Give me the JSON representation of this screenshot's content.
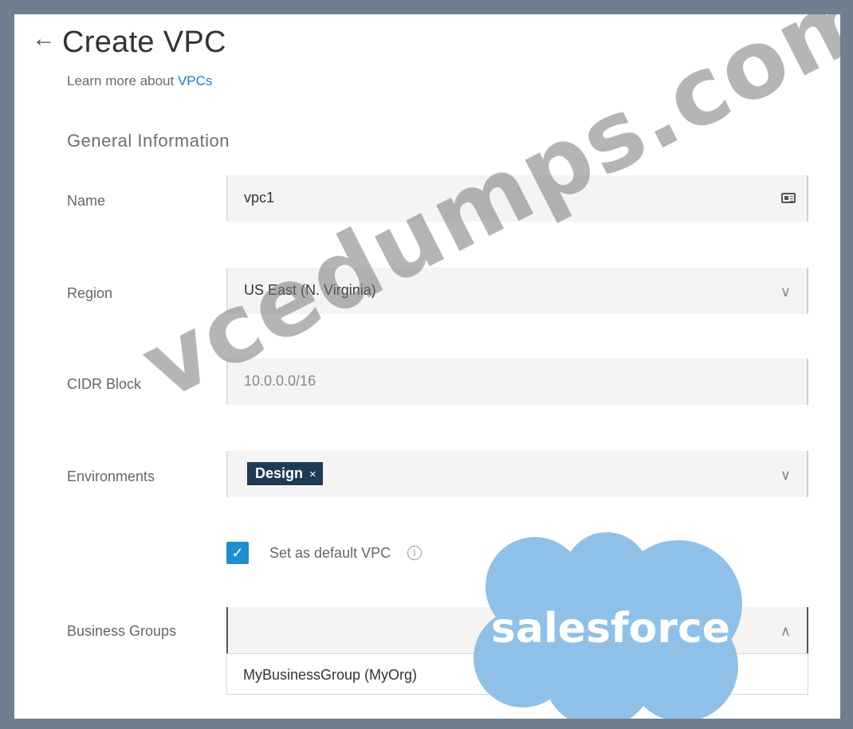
{
  "header": {
    "back_icon": "arrow-left-icon",
    "title": "Create VPC",
    "learn_more_prefix": "Learn more about",
    "learn_more_link": "VPCs"
  },
  "section": {
    "title": "General Information"
  },
  "form": {
    "name": {
      "label": "Name",
      "value": "vpc1",
      "icon": "card-icon"
    },
    "region": {
      "label": "Region",
      "value": "US East (N. Virginia)"
    },
    "cidr": {
      "label": "CIDR Block",
      "placeholder": "10.0.0.0/16"
    },
    "environments": {
      "label": "Environments",
      "tags": [
        "Design"
      ]
    },
    "default_vpc": {
      "label": "Set as default VPC",
      "checked": true
    },
    "business_groups": {
      "label": "Business Groups",
      "options": [
        "MyBusinessGroup (MyOrg)"
      ]
    }
  },
  "overlays": {
    "watermark": "vcedumps.com",
    "logo": "salesforce"
  },
  "colors": {
    "link": "#1a7cc8",
    "checkbox": "#1d8fd1",
    "tag_bg": "#1f3a55",
    "logo_cloud": "#8fc1e8"
  }
}
